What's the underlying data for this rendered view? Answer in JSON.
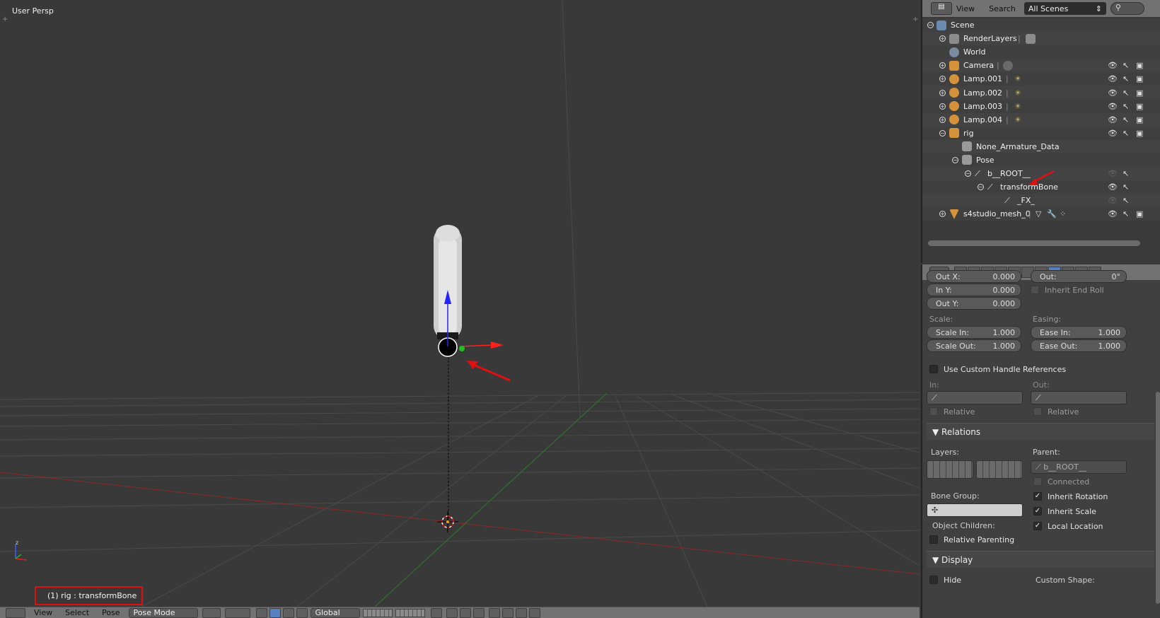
{
  "viewport": {
    "title": "User Persp",
    "status": "(1) rig : transformBone",
    "axis_label": "z"
  },
  "bottombar": {
    "view": "View",
    "select": "Select",
    "pose": "Pose",
    "mode": "Pose Mode",
    "orientation": "Global"
  },
  "outliner": {
    "view": "View",
    "search": "Search",
    "scenes": "All Scenes",
    "rows": [
      {
        "label": "Scene",
        "icon": "scene-icon"
      },
      {
        "label": "RenderLayers",
        "icon": "render-layers-icon"
      },
      {
        "label": "World",
        "icon": "world-icon"
      },
      {
        "label": "Camera",
        "icon": "camera-icon"
      },
      {
        "label": "Lamp.001",
        "icon": "lamp-icon"
      },
      {
        "label": "Lamp.002",
        "icon": "lamp-icon"
      },
      {
        "label": "Lamp.003",
        "icon": "lamp-icon"
      },
      {
        "label": "Lamp.004",
        "icon": "lamp-icon"
      },
      {
        "label": "rig",
        "icon": "armature-icon"
      },
      {
        "label": "None_Armature_Data",
        "icon": "armature-data-icon"
      },
      {
        "label": "Pose",
        "icon": "pose-icon"
      },
      {
        "label": "b__ROOT__",
        "icon": "bone-icon"
      },
      {
        "label": "transformBone",
        "icon": "bone-icon"
      },
      {
        "label": "_FX_",
        "icon": "bone-icon"
      },
      {
        "label": "s4studio_mesh_0",
        "icon": "mesh-icon"
      }
    ]
  },
  "props": {
    "out_x_label": "Out X:",
    "out_x": "0.000",
    "in_y_label": "In Y:",
    "in_y": "0.000",
    "out_y_label": "Out Y:",
    "out_y": "0.000",
    "out_label": "Out:",
    "out": "0°",
    "inherit_end_roll": "Inherit End Roll",
    "scale": "Scale:",
    "easing": "Easing:",
    "scale_in_label": "Scale In:",
    "scale_in": "1.000",
    "scale_out_label": "Scale Out:",
    "scale_out": "1.000",
    "ease_in_label": "Ease In:",
    "ease_in": "1.000",
    "ease_out_label": "Ease Out:",
    "ease_out": "1.000",
    "use_custom_handle": "Use Custom Handle References",
    "in": "In:",
    "out2": "Out:",
    "relative": "Relative",
    "relations": "Relations",
    "layers": "Layers:",
    "parent": "Parent:",
    "parent_value": "b__ROOT__",
    "connected": "Connected",
    "bone_group": "Bone Group:",
    "inherit_rotation": "Inherit Rotation",
    "inherit_scale": "Inherit Scale",
    "object_children": "Object Children:",
    "local_location": "Local Location",
    "relative_parenting": "Relative Parenting",
    "display": "Display",
    "hide": "Hide",
    "custom_shape": "Custom Shape:"
  },
  "colors": {
    "accent": "#5680c2",
    "annotation": "#e01010"
  }
}
